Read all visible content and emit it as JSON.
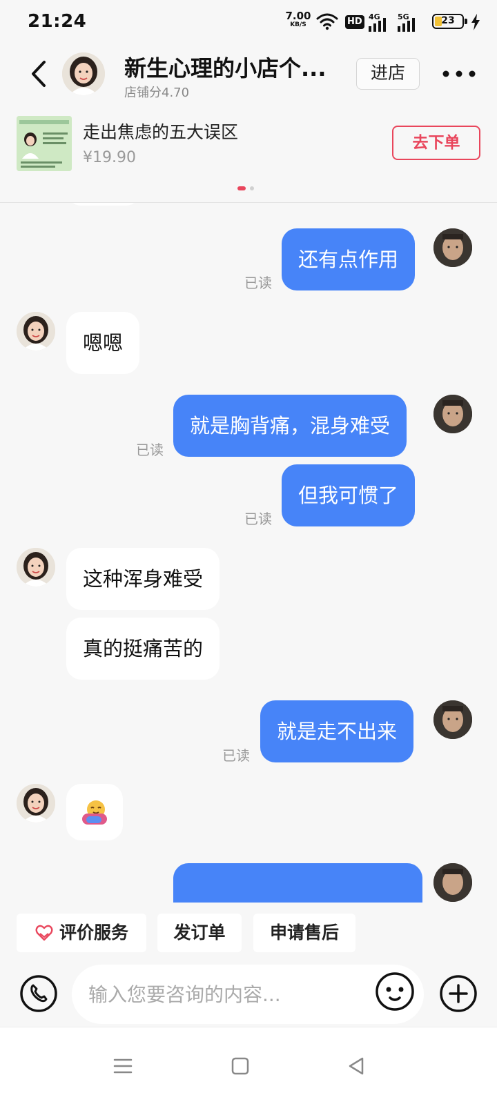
{
  "status_bar": {
    "time": "21:24",
    "net_speed_value": "7.00",
    "net_speed_unit": "KB/S",
    "hd_label": "HD",
    "network_4g": "4G",
    "network_5g": "5G",
    "battery_level": "23"
  },
  "header": {
    "shop_name": "新生心理的小店个...",
    "shop_score": "店铺分4.70",
    "enter_shop_label": "进店"
  },
  "product": {
    "title": "走出焦虑的五大误区",
    "price": "¥19.90",
    "order_label": "去下单"
  },
  "colors": {
    "outgoing_bubble": "#4784f8",
    "accent_red": "#e9465c",
    "background": "#f7f7f7"
  },
  "chat": {
    "read_label": "已读",
    "messages": [
      {
        "from": "me",
        "text": "还有点作用",
        "read": true
      },
      {
        "from": "shop",
        "text": "嗯嗯"
      },
      {
        "from": "me",
        "text": "就是胸背痛，混身难受",
        "read": true
      },
      {
        "from": "me",
        "text": "但我可惯了",
        "read": true
      },
      {
        "from": "shop",
        "text": "这种浑身难受"
      },
      {
        "from": "shop",
        "text": "真的挺痛苦的"
      },
      {
        "from": "me",
        "text": "就是走不出来",
        "read": true
      },
      {
        "from": "shop",
        "text": "🫂",
        "emoji": "hug-emoji"
      }
    ]
  },
  "quick_actions": {
    "rate_service": "评价服务",
    "send_order": "发订单",
    "after_sales": "申请售后"
  },
  "input": {
    "placeholder": "输入您要咨询的内容..."
  },
  "icons": {
    "back": "chevron-left-icon",
    "more": "more-dots-icon",
    "phone": "phone-icon",
    "emoji": "emoji-face-icon",
    "plus": "plus-circle-icon",
    "rate": "heart-hands-icon"
  }
}
